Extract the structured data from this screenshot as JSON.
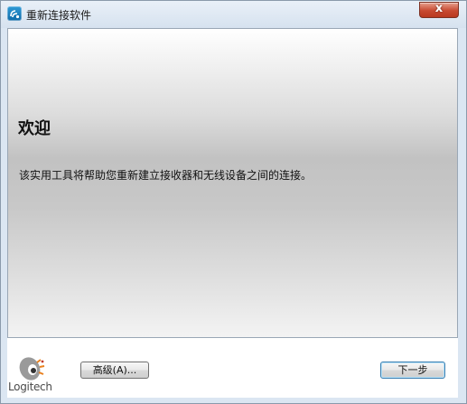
{
  "window": {
    "title": "重新连接软件",
    "close_glyph": "x"
  },
  "main": {
    "heading": "欢迎",
    "description": "该实用工具将帮助您重新建立接收器和无线设备之间的连接。"
  },
  "footer": {
    "logo_text": "Logitech",
    "advanced_button": "高级(A)...",
    "next_button": "下一步"
  },
  "colors": {
    "close_button": "#c84a31",
    "logo_orange": "#e8801e",
    "logo_grey": "#9a9a9a"
  },
  "icons": {
    "app": "logitech-connect-icon",
    "close": "close-icon",
    "logo": "logitech-logo"
  }
}
